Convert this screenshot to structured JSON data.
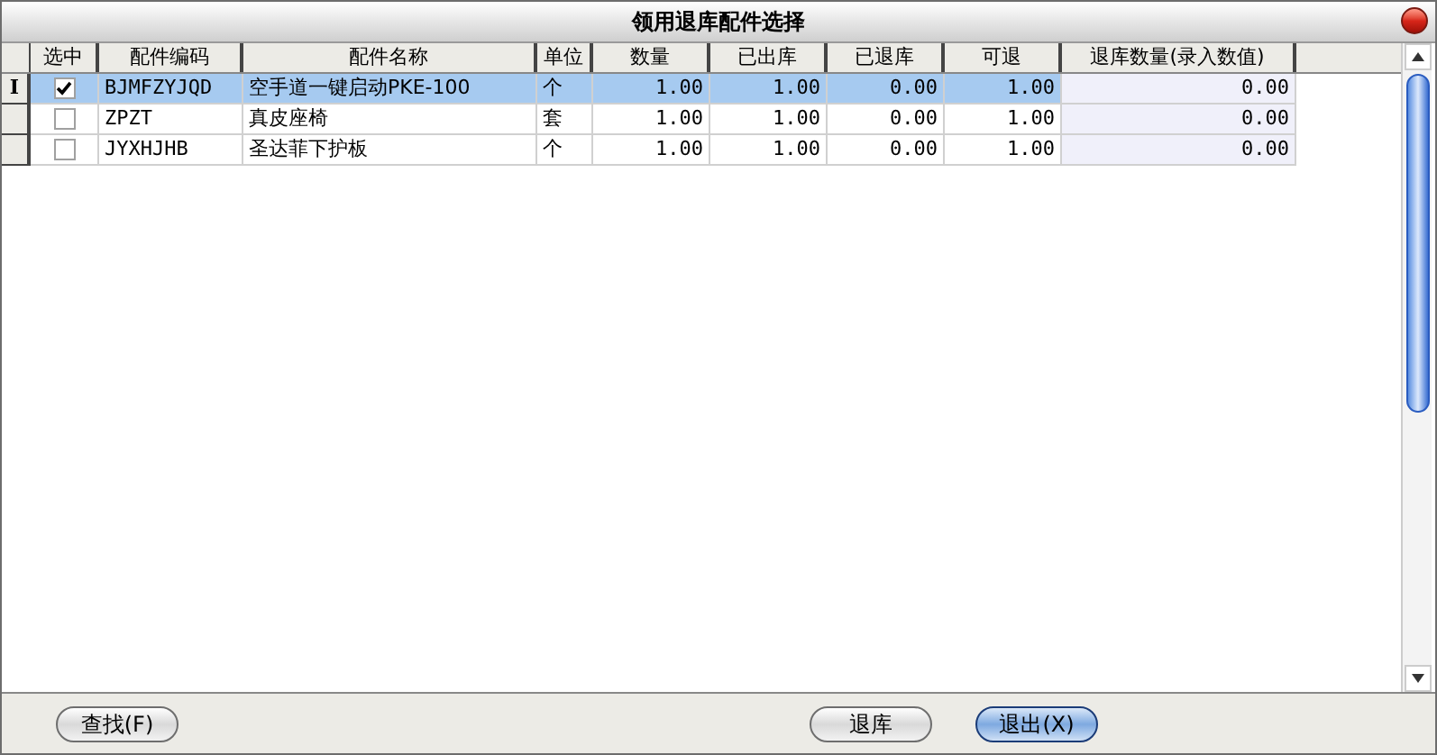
{
  "window": {
    "title": "领用退库配件选择"
  },
  "table": {
    "columns": [
      "选中",
      "配件编码",
      "配件名称",
      "单位",
      "数量",
      "已出库",
      "已退库",
      "可退",
      "退库数量(录入数值)"
    ],
    "rows": [
      {
        "selected": true,
        "indicator": "I",
        "cells": [
          {
            "kind": "checkbox",
            "checked": true
          },
          "BJMFZYJQD",
          "空手道一键启动PKE-100",
          "个",
          "1.00",
          "1.00",
          "0.00",
          "1.00",
          "0.00"
        ]
      },
      {
        "selected": false,
        "cells": [
          {
            "kind": "checkbox",
            "checked": false
          },
          "ZPZT",
          "真皮座椅",
          "套",
          "1.00",
          "1.00",
          "0.00",
          "1.00",
          "0.00"
        ]
      },
      {
        "selected": false,
        "cells": [
          {
            "kind": "checkbox",
            "checked": false
          },
          "JYXHJHB",
          "圣达菲下护板",
          "个",
          "1.00",
          "1.00",
          "0.00",
          "1.00",
          "0.00"
        ]
      }
    ]
  },
  "buttons": [
    {
      "label": "查找(F)",
      "kind": "normal"
    },
    {
      "label": "退库",
      "kind": "normal"
    },
    {
      "label": "退出(X)",
      "kind": "default"
    }
  ]
}
